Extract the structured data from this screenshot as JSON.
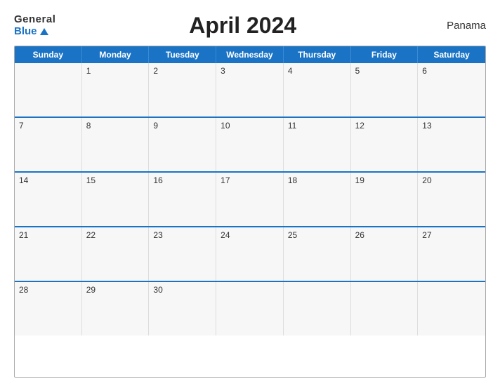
{
  "logo": {
    "general": "General",
    "blue": "Blue"
  },
  "title": "April 2024",
  "country": "Panama",
  "header_days": [
    "Sunday",
    "Monday",
    "Tuesday",
    "Wednesday",
    "Thursday",
    "Friday",
    "Saturday"
  ],
  "weeks": [
    [
      null,
      "1",
      "2",
      "3",
      "4",
      "5",
      "6"
    ],
    [
      "7",
      "8",
      "9",
      "10",
      "11",
      "12",
      "13"
    ],
    [
      "14",
      "15",
      "16",
      "17",
      "18",
      "19",
      "20"
    ],
    [
      "21",
      "22",
      "23",
      "24",
      "25",
      "26",
      "27"
    ],
    [
      "28",
      "29",
      "30",
      null,
      null,
      null,
      null
    ]
  ]
}
